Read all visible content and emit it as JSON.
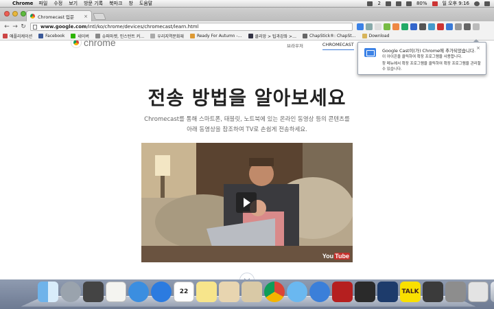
{
  "menubar": {
    "app_name": "Chrome",
    "items": [
      "파일",
      "수정",
      "보기",
      "방문 기록",
      "북마크",
      "창",
      "도움말"
    ],
    "battery": "80%",
    "clock": "일 오후 9:16",
    "badge": "2"
  },
  "tab": {
    "title": "Chromecast 입문",
    "close": "×"
  },
  "toolbar": {
    "url_host": "www.google.com",
    "url_path": "/intl/ko/chrome/devices/chromecast/learn.html"
  },
  "bookmarks": [
    "애플리케이션",
    "Facebook",
    "네이버",
    "슈퍼마켓, 인스턴트 커…",
    "우리지역문화재",
    "Ready For Autumn -…",
    "클리앙 > 팁과강좌 >…",
    "ChapStick®: ChapSt…",
    "Download"
  ],
  "page": {
    "logo_text": "chrome",
    "nav": [
      "브라우저",
      "CHROMECAST"
    ],
    "heading": "전송 방법을 알아보세요",
    "subtitle_line1": "Chromecast를 통해 스마트폰, 태블릿, 노트북에 있는 온라인 동영상 등의 콘텐츠를",
    "subtitle_line2": "아래 동영상을 참조하여 TV로 손쉽게 전송하세요.",
    "video_brand_a": "You",
    "video_brand_b": "Tube"
  },
  "bubble": {
    "title": "Google Cast이(가) Chrome에 추가되었습니다.",
    "line1": "이 아이콘을 클릭하여 확장 프로그램을 사용합니다.",
    "line2": "창 메뉴에서 확장 프로그램을 클릭하여 확장 프로그램을 관리할 수 있습니다.",
    "close": "×"
  },
  "dock": {
    "calendar_day": "22",
    "kakao_label": "TALK"
  }
}
